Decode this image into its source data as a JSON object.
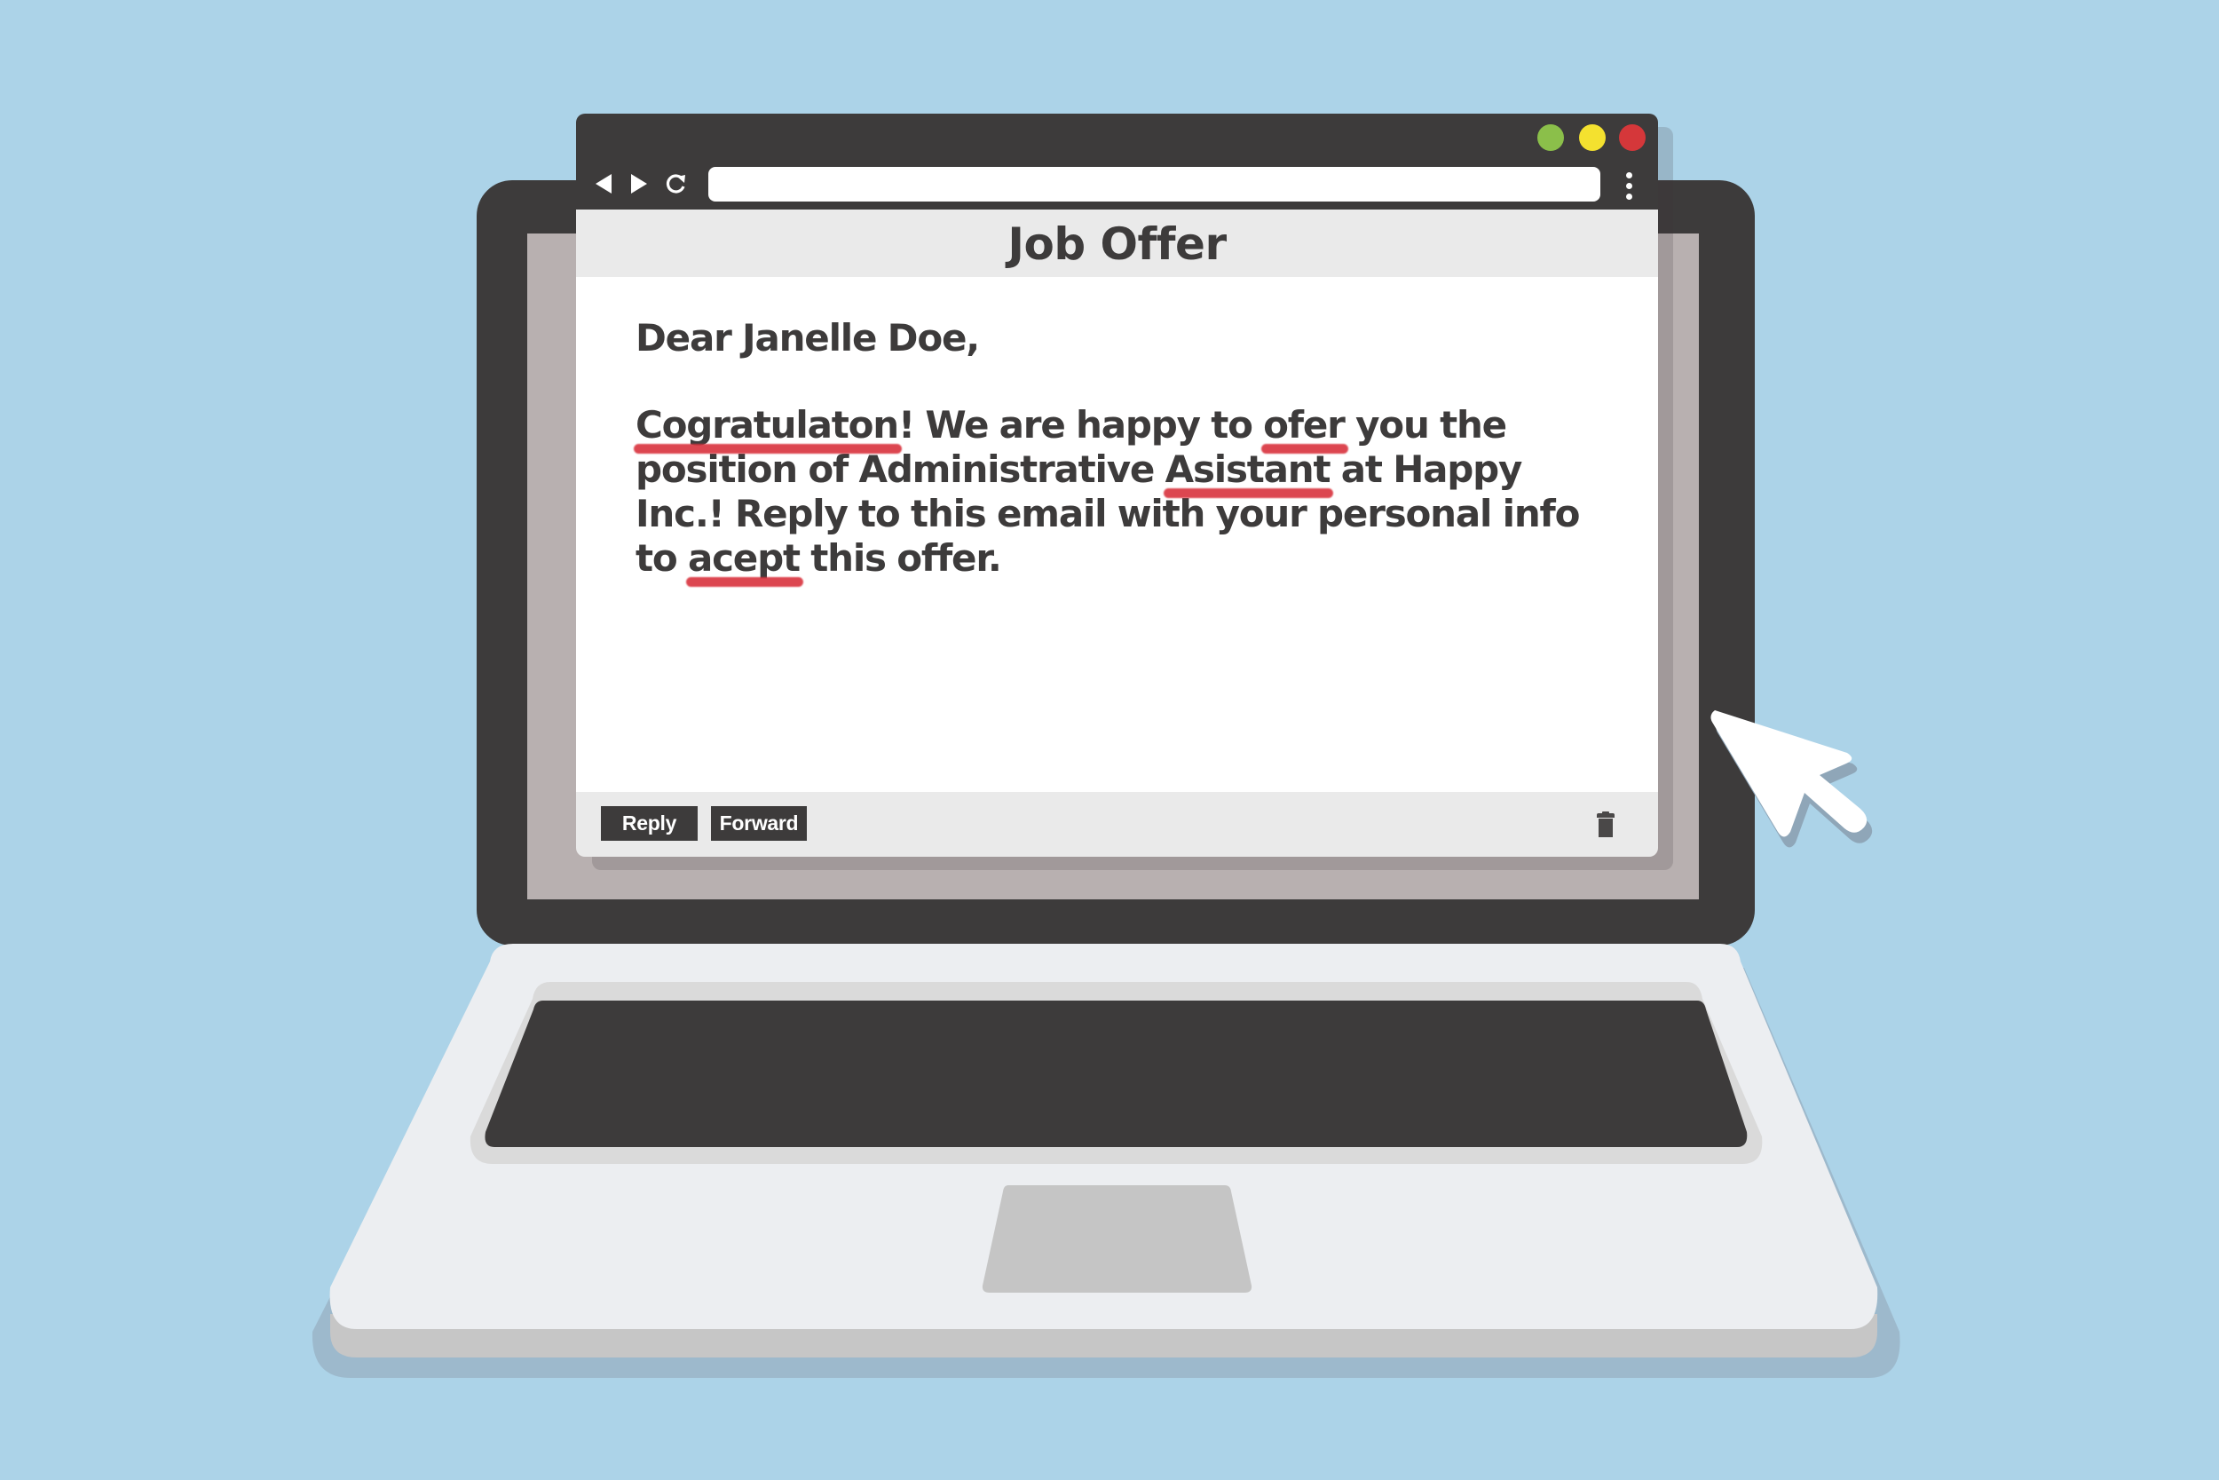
{
  "colors": {
    "background": "#acd3e8",
    "bezel": "#3d3b3b",
    "screen": "#b8b0b0",
    "base": "#eceef1",
    "keyboard_well": "#dadada",
    "trackpad": "#c5c5c5",
    "window_green": "#8bbf4a",
    "window_yellow": "#f4e12f",
    "window_red": "#d5373a",
    "spell_error": "#d9333e"
  },
  "browser": {
    "url": "",
    "back_icon": "back-arrow-icon",
    "forward_icon": "forward-arrow-icon",
    "reload_icon": "reload-icon",
    "menu_icon": "kebab-menu-icon",
    "reload_glyph": "↻"
  },
  "email": {
    "subject": "Job Offer",
    "greeting": "Dear Janelle Doe,",
    "body_segments": [
      {
        "text": "Cogratulaton",
        "misspelled": true
      },
      {
        "text": "! We are happy to ",
        "misspelled": false
      },
      {
        "text": "ofer",
        "misspelled": true
      },
      {
        "text": " you the position of Administrative ",
        "misspelled": false
      },
      {
        "text": "Asistant",
        "misspelled": true
      },
      {
        "text": " at  Happy Inc.! Reply to this email with your personal info to ",
        "misspelled": false
      },
      {
        "text": "acept",
        "misspelled": true
      },
      {
        "text": " this offer.",
        "misspelled": false
      }
    ]
  },
  "footer": {
    "reply_label": "Reply",
    "forward_label": "Forward",
    "delete_icon": "trash-icon"
  },
  "cursor": {
    "icon": "mouse-pointer-icon"
  }
}
